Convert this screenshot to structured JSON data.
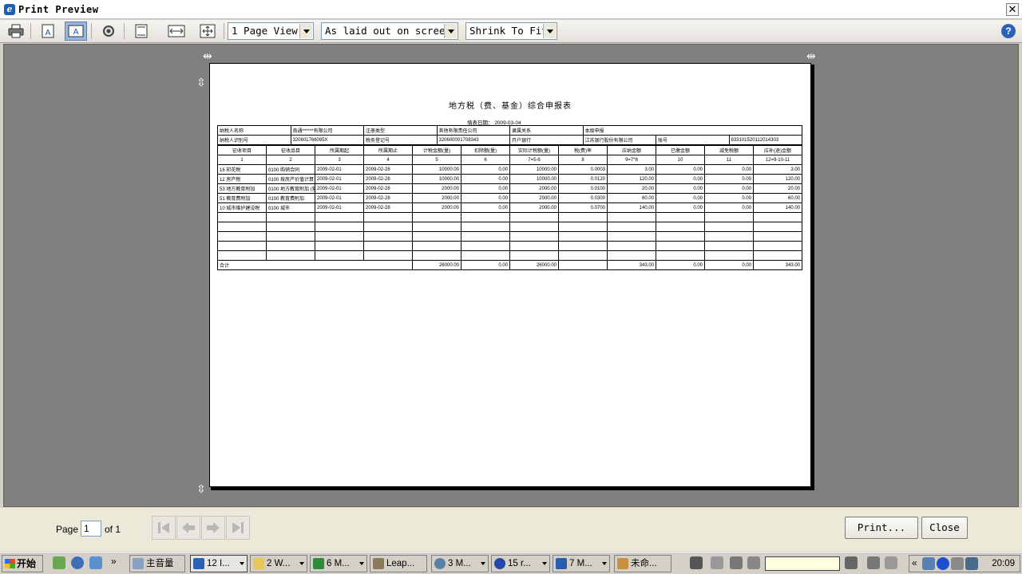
{
  "window": {
    "title": "Print Preview"
  },
  "toolbar": {
    "page_view": "1 Page View",
    "layout": "As laid out on screen",
    "fit": "Shrink To Fit"
  },
  "document": {
    "title": "地方税（费、基金）综合申报表",
    "date_label": "填表日期：",
    "date": "2009-03-04",
    "info_rows": [
      [
        "纳税人名称",
        "南通******有限公司",
        "注册类型",
        "其他有限责任公司",
        "隶属关系",
        "本级申报"
      ],
      [
        "纳税人识别号",
        "320601766095X",
        "税务登记号",
        "320600001708343",
        "开户银行",
        "江苏银行股份有限公司",
        "账号",
        "833101520112014303"
      ]
    ],
    "headers": [
      "征收项目",
      "征收品目",
      "所属期起",
      "所属期止",
      "计税金额(量)",
      "扣除额(量)",
      "实际计税额(量)",
      "税(费)率",
      "应纳金额",
      "已缴金额",
      "减免税额",
      "应补(退)金额"
    ],
    "header_numbers": [
      "1",
      "2",
      "3",
      "4",
      "5",
      "6",
      "7=5-6",
      "8",
      "9=7*8",
      "10",
      "11",
      "12=9-10-11"
    ],
    "rows": [
      [
        "16 印花税",
        "0100 购销合同",
        "2009-02-01",
        "2009-02-28",
        "10000.00",
        "0.00",
        "10000.00",
        "0.0003",
        "3.00",
        "0.00",
        "0.00",
        "3.00"
      ],
      [
        "12 房产税",
        "0100 按房产价值计算",
        "2009-02-01",
        "2009-02-28",
        "10000.00",
        "0.00",
        "10000.00",
        "0.0120",
        "120.00",
        "0.00",
        "0.00",
        "120.00"
      ],
      [
        "53 地方教育附加",
        "0100 地方教育附加 (营",
        "2009-02-01",
        "2009-02-28",
        "2000.00",
        "0.00",
        "2000.00",
        "0.0100",
        "20.00",
        "0.00",
        "0.00",
        "20.00"
      ],
      [
        "51 教育费附加",
        "0100 教育费附加",
        "2009-02-01",
        "2009-02-28",
        "2000.00",
        "0.00",
        "2000.00",
        "0.0300",
        "60.00",
        "0.00",
        "0.00",
        "60.00"
      ],
      [
        "10 城市维护建设税",
        "0100 城市",
        "2009-02-01",
        "2009-02-28",
        "2000.00",
        "0.00",
        "2000.00",
        "0.0700",
        "140.00",
        "0.00",
        "0.00",
        "140.00"
      ]
    ],
    "total_label": "合计",
    "totals": [
      "26000.00",
      "0.00",
      "26000.00",
      "",
      "343.00",
      "0.00",
      "0.00",
      "343.00"
    ]
  },
  "status": {
    "page_label": "Page",
    "page_value": "1",
    "of_label": "of 1",
    "print_button": "Print...",
    "close_button": "Close"
  },
  "taskbar": {
    "start": "开始",
    "items": [
      {
        "label": "主音量"
      },
      {
        "label": "12 I..."
      },
      {
        "label": "2 W..."
      },
      {
        "label": "6 M..."
      },
      {
        "label": "Leap..."
      },
      {
        "label": "3 M..."
      },
      {
        "label": "15 r..."
      },
      {
        "label": "7 M..."
      },
      {
        "label": "未命..."
      }
    ],
    "clock": "20:09"
  },
  "colors": {
    "canvas": "#808080",
    "chrome": "#d4d0c8",
    "toolbar_pressed": "#9cb6d8"
  }
}
